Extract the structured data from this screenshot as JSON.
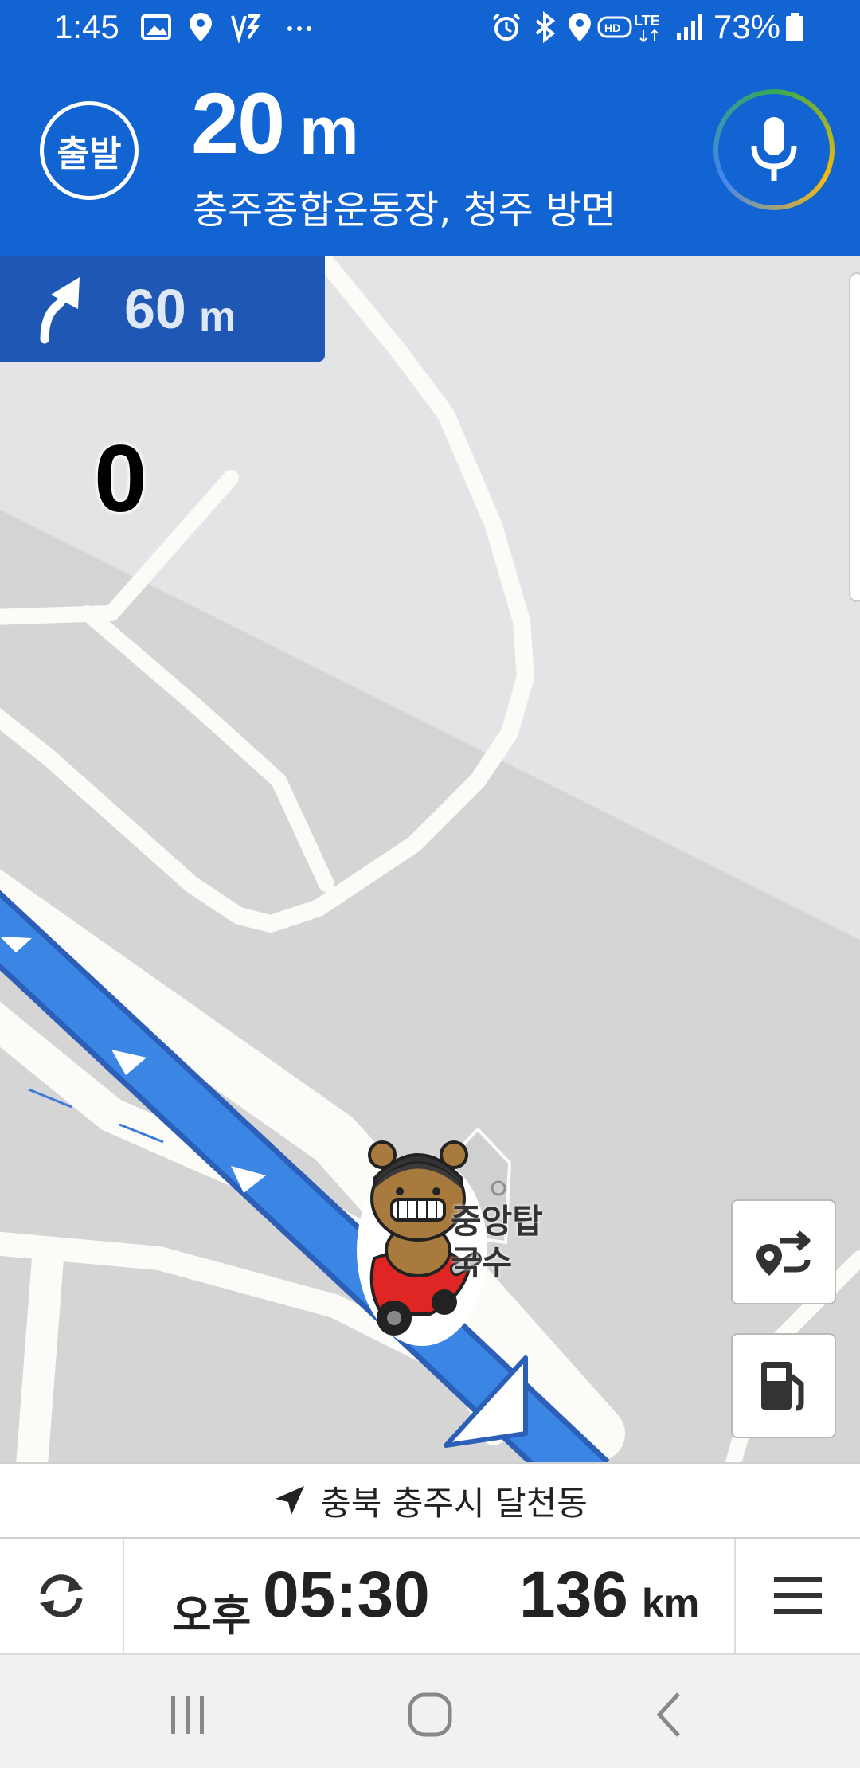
{
  "status_bar": {
    "time": "1:45",
    "battery": "73%",
    "left_icons": [
      "image-icon",
      "location-icon",
      "vpn-icon",
      "more-icon"
    ],
    "right_icons": [
      "alarm-icon",
      "bluetooth-icon",
      "location-icon",
      "hd-voice-icon",
      "lte-icon",
      "signal-icon",
      "battery-icon"
    ]
  },
  "guidance": {
    "badge_label": "출발",
    "distance": "20",
    "distance_unit": "m",
    "direction_text": "충주종합운동장, 청주 방면",
    "mic_icon": "microphone-icon"
  },
  "next_turn": {
    "distance": "60",
    "unit": "m",
    "icon": "bear-right-arrow-icon"
  },
  "speed": "0",
  "map": {
    "poi_label_line1": "중앙탑",
    "poi_label_line2": "국수",
    "route_color": "#3b86e4"
  },
  "buttons": {
    "reroute_icon": "route-alternative-icon",
    "fuel_icon": "fuel-pump-icon"
  },
  "location_bar": {
    "icon": "navigation-arrow-icon",
    "text": "충북 충주시 달천동"
  },
  "bottom": {
    "eta_prefix": "오후",
    "eta_time": "05:30",
    "remaining_distance": "136",
    "remaining_unit": "km",
    "refresh_icon": "refresh-icon",
    "menu_icon": "menu-icon"
  },
  "system_nav": {
    "recents_icon": "recents-icon",
    "home_icon": "home-icon",
    "back_icon": "back-icon"
  },
  "colors": {
    "header_blue": "#1264d2",
    "turn_box_blue": "#1e58b4"
  }
}
